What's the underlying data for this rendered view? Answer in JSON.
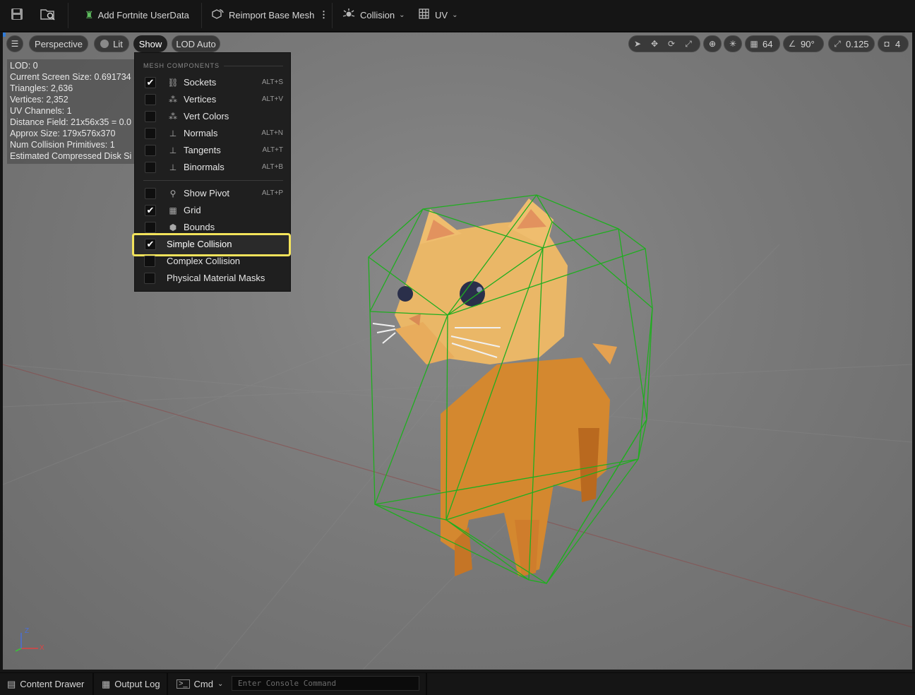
{
  "toolbar": {
    "add_userdata_label": "Add Fortnite UserData",
    "reimport_label": "Reimport Base Mesh",
    "collision_label": "Collision",
    "uv_label": "UV"
  },
  "viewport_bar": {
    "perspective": "Perspective",
    "lit": "Lit",
    "show": "Show",
    "lod": "LOD Auto",
    "grid_size": "64",
    "rotation_snap": "90°",
    "scale_snap": "0.125",
    "camera_speed": "4"
  },
  "stats": [
    "LOD:  0",
    "Current Screen Size:  0.691734",
    "Triangles:  2,636",
    "Vertices:  2,352",
    "UV Channels:  1",
    "Distance Field:  21x56x35 = 0.0",
    "Approx Size: 179x576x370",
    "Num Collision Primitives:  1",
    "Estimated Compressed Disk Si"
  ],
  "show_menu": {
    "section": "MESH COMPONENTS",
    "items": [
      {
        "label": "Sockets",
        "shortcut": "ALT+S",
        "checked": "✔"
      },
      {
        "label": "Vertices",
        "shortcut": "ALT+V",
        "checked": ""
      },
      {
        "label": "Vert Colors",
        "shortcut": "",
        "checked": ""
      },
      {
        "label": "Normals",
        "shortcut": "ALT+N",
        "checked": ""
      },
      {
        "label": "Tangents",
        "shortcut": "ALT+T",
        "checked": ""
      },
      {
        "label": "Binormals",
        "shortcut": "ALT+B",
        "checked": ""
      },
      {
        "label": "Show Pivot",
        "shortcut": "ALT+P",
        "checked": ""
      },
      {
        "label": "Grid",
        "shortcut": "",
        "checked": "✔"
      },
      {
        "label": "Bounds",
        "shortcut": "",
        "checked": ""
      },
      {
        "label": "Simple Collision",
        "shortcut": "",
        "checked": "✔"
      },
      {
        "label": "Complex Collision",
        "shortcut": "",
        "checked": ""
      },
      {
        "label": "Physical Material Masks",
        "shortcut": "",
        "checked": ""
      }
    ]
  },
  "axis": {
    "z": "Z",
    "x": "X"
  },
  "bottombar": {
    "content_drawer": "Content Drawer",
    "output_log": "Output Log",
    "cmd": "Cmd",
    "console_placeholder": "Enter Console Command"
  },
  "colors": {
    "accent_highlight": "#f3e35b",
    "collision_wire": "#1fae1f",
    "cat": "#e8a24a"
  }
}
